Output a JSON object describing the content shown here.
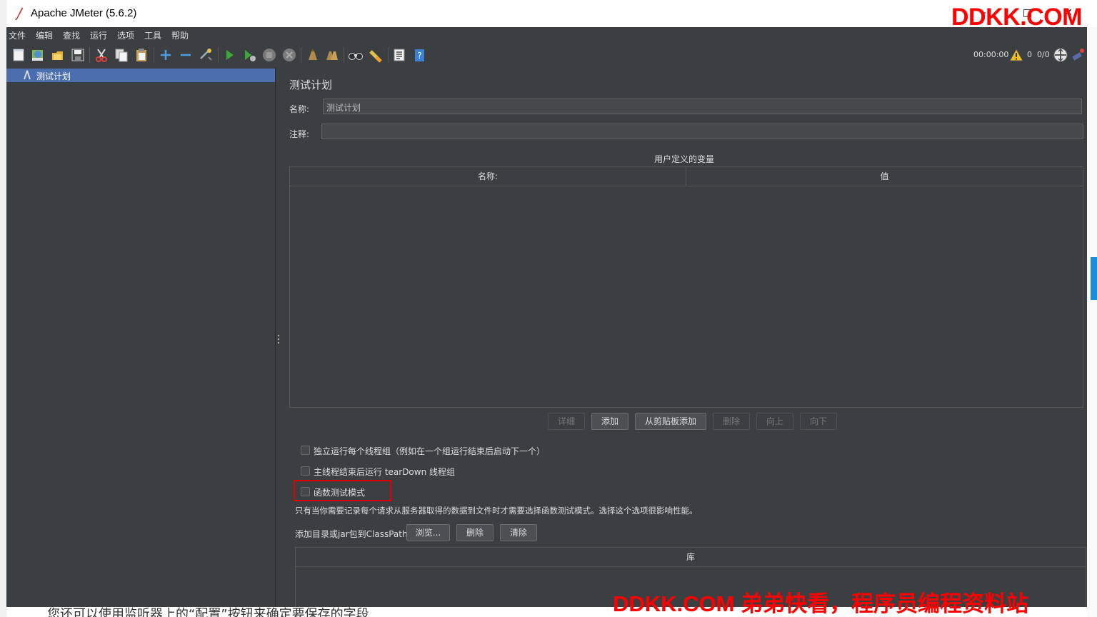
{
  "window": {
    "title": "Apache JMeter (5.6.2)",
    "minimize": "–",
    "maximize": "□",
    "close": "✕"
  },
  "watermark": {
    "top": "DDKK.COM",
    "bottom": "DDKK.COM 弟弟快看，程序员编程资料站"
  },
  "background": {
    "bottom_text": "您还可以使用监听器上的“配置”按钮来确定要保存的字段"
  },
  "menu": [
    "文件",
    "编辑",
    "查找",
    "运行",
    "选项",
    "工具",
    "帮助"
  ],
  "toolbar": {
    "icons": [
      "new-icon",
      "templates-icon",
      "open-icon",
      "save-icon",
      "cut-icon",
      "copy-icon",
      "paste-icon",
      "expand-icon",
      "collapse-icon",
      "toggle-icon",
      "start-icon",
      "start-no-pause-icon",
      "stop-icon",
      "shutdown-icon",
      "clear-icon",
      "clear-all-icon",
      "search-icon",
      "reset-search-icon",
      "function-helper-icon",
      "help-icon"
    ],
    "timer": "00:00:00",
    "warnings": "0",
    "threads": "0/0"
  },
  "tree": {
    "selected": "测试计划"
  },
  "panel": {
    "title": "测试计划",
    "name_label": "名称:",
    "name_value": "测试计划",
    "comment_label": "注释:",
    "comment_value": "",
    "vars_title": "用户定义的变量",
    "vars_columns": [
      "名称:",
      "值"
    ],
    "buttons": [
      "详细",
      "添加",
      "从剪贴板添加",
      "删除",
      "向上",
      "向下"
    ],
    "checkbox_serial": "独立运行每个线程组（例如在一个组运行结束后启动下一个）",
    "checkbox_teardown": "主线程结束后运行 tearDown 线程组",
    "checkbox_functional": "函数测试模式",
    "functional_note": "只有当你需要记录每个请求从服务器取得的数据到文件时才需要选择函数测试模式。选择这个选项很影响性能。",
    "classpath_label": "添加目录或jar包到ClassPath",
    "classpath_buttons": [
      "浏览...",
      "删除",
      "清除"
    ],
    "lib_column": "库"
  }
}
